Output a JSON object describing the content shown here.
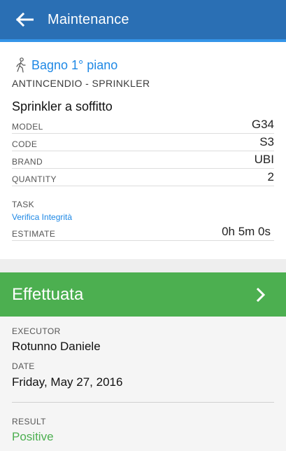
{
  "header": {
    "title": "Maintenance",
    "back_icon": "arrow-back-icon"
  },
  "location": {
    "icon": "walking-person-icon",
    "name": "Bagno 1° piano"
  },
  "category": "ANTINCENDIO - SPRINKLER",
  "item_name": "Sprinkler a soffitto",
  "details": [
    {
      "label": "MODEL",
      "value": "G34"
    },
    {
      "label": "CODE",
      "value": "S3"
    },
    {
      "label": "BRAND",
      "value": "UBI"
    },
    {
      "label": "QUANTITY",
      "value": "2"
    }
  ],
  "task": {
    "label": "TASK",
    "value": "Verifica Integrità"
  },
  "estimate": {
    "label": "ESTIMATE",
    "value": "0h 5m 0s"
  },
  "status": {
    "label": "Effettuata",
    "icon": "chevron-right-icon",
    "color": "#4caf50"
  },
  "executor": {
    "label": "EXECUTOR",
    "value": "Rotunno Daniele"
  },
  "date": {
    "label": "DATE",
    "value": "Friday, May 27, 2016"
  },
  "result": {
    "label": "RESULT",
    "value": "Positive"
  },
  "colors": {
    "appbar": "#2a6fb4",
    "accent": "#1e88e5",
    "success": "#4caf50"
  }
}
